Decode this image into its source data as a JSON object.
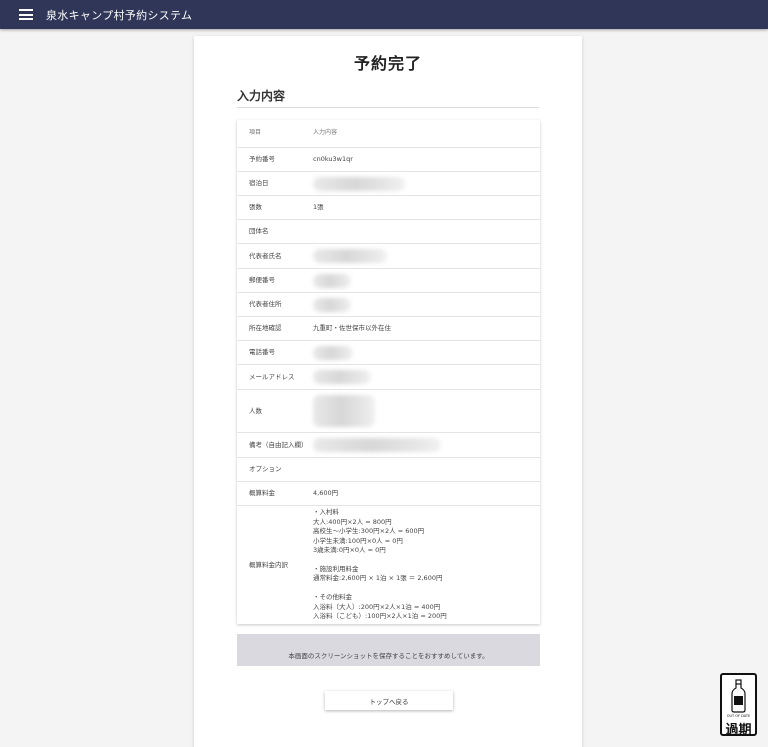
{
  "appbar": {
    "title": "泉水キャンプ村予約システム"
  },
  "page": {
    "title": "予約完了",
    "section_title": "入力内容",
    "notice": "本画面のスクリーンショットを保存することをおすすめしています。",
    "back_button": "トップへ戻る"
  },
  "table": {
    "header": {
      "label": "項目",
      "value": "入力内容"
    },
    "rows": [
      {
        "label": "予約番号",
        "value": "cn0ku3w1qr"
      },
      {
        "label": "宿泊日",
        "value": ""
      },
      {
        "label": "張数",
        "value": "1張"
      },
      {
        "label": "団体名",
        "value": ""
      },
      {
        "label": "代表者氏名",
        "value": ""
      },
      {
        "label": "郵便番号",
        "value": ""
      },
      {
        "label": "代表者住所",
        "value": ""
      },
      {
        "label": "所在地確認",
        "value": "九重町・佐世保市以外在住"
      },
      {
        "label": "電話番号",
        "value": ""
      },
      {
        "label": "メールアドレス",
        "value": ""
      },
      {
        "label": "人数",
        "value": ""
      },
      {
        "label": "備考（自由記入欄）",
        "value": ""
      },
      {
        "label": "オプション",
        "value": ""
      },
      {
        "label": "概算料金",
        "value": "4,600円"
      },
      {
        "label": "概算料金内訳",
        "value": "・入村料\n大人:400円×2人 = 800円\n高校生～小学生:300円×2人 = 600円\n小学生未満:100円×0人 = 0円\n3歳未満:0円×0人 = 0円\n\n・施設利用料金\n通常料金:2,600円 × 1泊 × 1張 ＝ 2,600円\n\n・その他料金\n入浴料（大人）:200円×2人×1泊 = 400円\n入浴料（こども）:100円×2人×1泊 = 200円"
      }
    ]
  },
  "badge": {
    "small_text": "OUT OF DATE",
    "big_text": "過期"
  },
  "colors": {
    "appbar": "#2f3658",
    "background": "#f4f4f4",
    "notice_bg": "#d9d9df"
  }
}
